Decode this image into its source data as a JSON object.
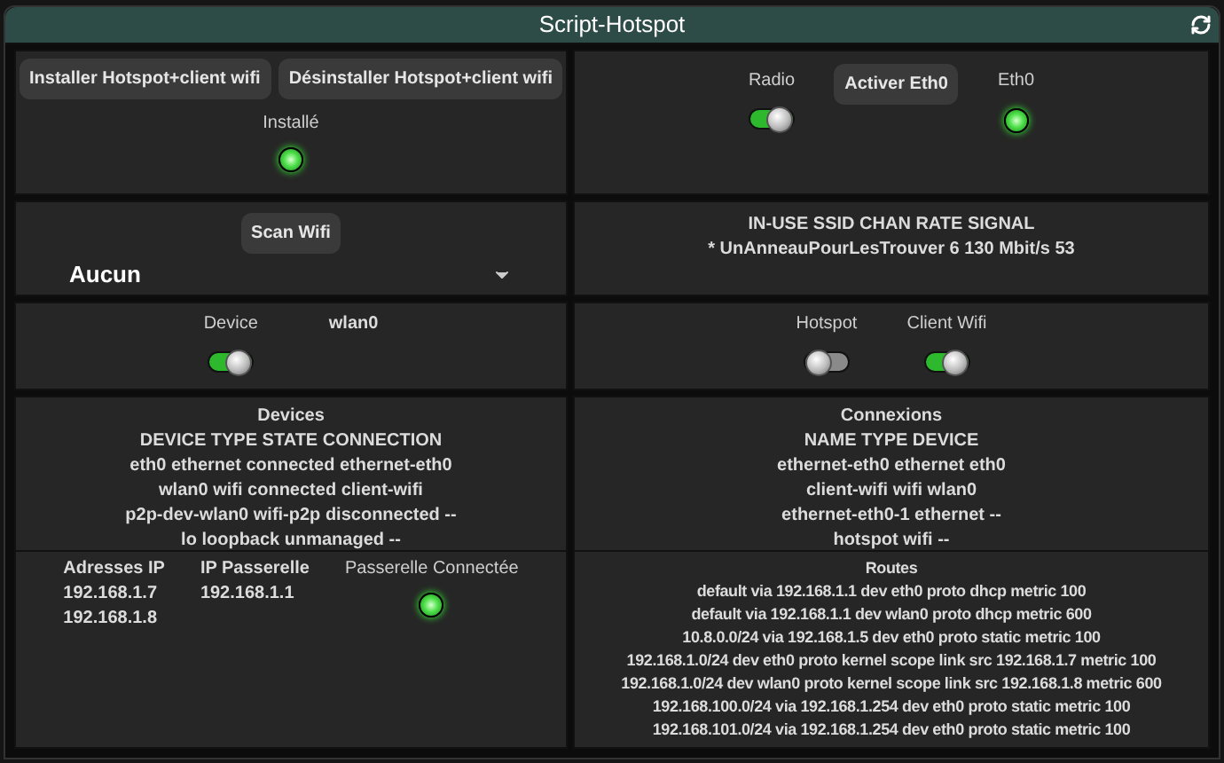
{
  "title": "Script-Hotspot",
  "install_panel": {
    "buttons": [
      "Installer Hotspot+client wifi",
      "Désinstaller Hotspot+client wifi"
    ],
    "indicator": {
      "label": "Installé",
      "on": true
    }
  },
  "radio_panel": {
    "radio": {
      "label": "Radio",
      "on": true
    },
    "button": "Activer Eth0",
    "eth0": {
      "label": "Eth0",
      "on": true
    }
  },
  "scan_panel": {
    "button": "Scan Wifi",
    "dropdown": {
      "value": "Aucun"
    }
  },
  "wifi_list": {
    "header": "IN-USE SSID CHAN RATE SIGNAL",
    "lines": [
      "* UnAnneauPourLesTrouver 6 130 Mbit/s 53"
    ]
  },
  "device_panel": {
    "switch": {
      "label": "Device",
      "on": true
    },
    "value": "wlan0"
  },
  "mode_panel": {
    "switches": [
      {
        "label": "Hotspot",
        "on": false
      },
      {
        "label": "Client Wifi",
        "on": true
      }
    ]
  },
  "devices": {
    "title": "Devices",
    "header": "DEVICE TYPE STATE CONNECTION",
    "lines": [
      "eth0 ethernet connected ethernet-eth0",
      "wlan0 wifi connected client-wifi",
      "p2p-dev-wlan0 wifi-p2p disconnected --",
      "lo loopback unmanaged --"
    ]
  },
  "connexions": {
    "title": "Connexions",
    "header": "NAME TYPE DEVICE",
    "lines": [
      "ethernet-eth0 ethernet eth0",
      "client-wifi wifi wlan0",
      "ethernet-eth0-1 ethernet --",
      "hotspot wifi --"
    ]
  },
  "network": {
    "columns": [
      {
        "label": "Adresses IP",
        "values": [
          "192.168.1.7",
          "192.168.1.8"
        ]
      },
      {
        "label": "IP Passerelle",
        "values": [
          "192.168.1.1"
        ]
      }
    ],
    "gateway": {
      "label": "Passerelle Connectée",
      "on": true
    }
  },
  "routes": {
    "title": "Routes",
    "lines": [
      "default via 192.168.1.1 dev eth0 proto dhcp metric 100",
      "default via 192.168.1.1 dev wlan0 proto dhcp metric 600",
      "10.8.0.0/24 via 192.168.1.5 dev eth0 proto static metric 100",
      "192.168.1.0/24 dev eth0 proto kernel scope link src 192.168.1.7 metric 100",
      "192.168.1.0/24 dev wlan0 proto kernel scope link src 192.168.1.8 metric 600",
      "192.168.100.0/24 via 192.168.1.254 dev eth0 proto static metric 100",
      "192.168.101.0/24 via 192.168.1.254 dev eth0 proto static metric 100"
    ]
  }
}
